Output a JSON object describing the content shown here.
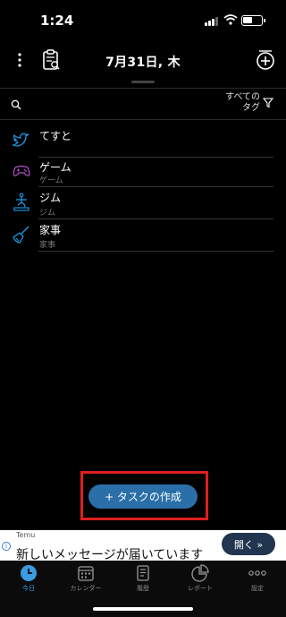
{
  "status_bar": {
    "time": "1:24",
    "battery_level": 0.55
  },
  "header": {
    "date_title": "7月31日, 木",
    "icons": [
      "more-vertical-icon",
      "clipboard-icon",
      "add-circle-icon"
    ]
  },
  "filter": {
    "tag_label": "すべての\nタグ"
  },
  "tasks": [
    {
      "title": "てすと",
      "subtitle": "",
      "icon": "twitter-bird-icon",
      "color": "#1da1f2"
    },
    {
      "title": "ゲーム",
      "subtitle": "ゲーム",
      "icon": "gamepad-icon",
      "color": "#b84fd1"
    },
    {
      "title": "ジム",
      "subtitle": "ジム",
      "icon": "gym-icon",
      "color": "#1da1f2"
    },
    {
      "title": "家事",
      "subtitle": "家事",
      "icon": "broom-icon",
      "color": "#1da1f2"
    }
  ],
  "create_button": {
    "label": "+ タスクの作成"
  },
  "ad": {
    "brand": "Temu",
    "message": "新しいメッセージが届いています",
    "open_label": "開く »"
  },
  "bottom_nav": [
    {
      "label": "今日",
      "icon": "clock-icon",
      "active": true
    },
    {
      "label": "カレンダー",
      "icon": "calendar-icon",
      "active": false
    },
    {
      "label": "履歴",
      "icon": "history-icon",
      "active": false
    },
    {
      "label": "レポート",
      "icon": "pie-chart-icon",
      "active": false
    },
    {
      "label": "設定",
      "icon": "more-dots-icon",
      "active": false
    }
  ],
  "colors": {
    "accent": "#2a6fa8",
    "highlight_frame": "#e01e1e",
    "active_nav": "#3a9be0"
  }
}
